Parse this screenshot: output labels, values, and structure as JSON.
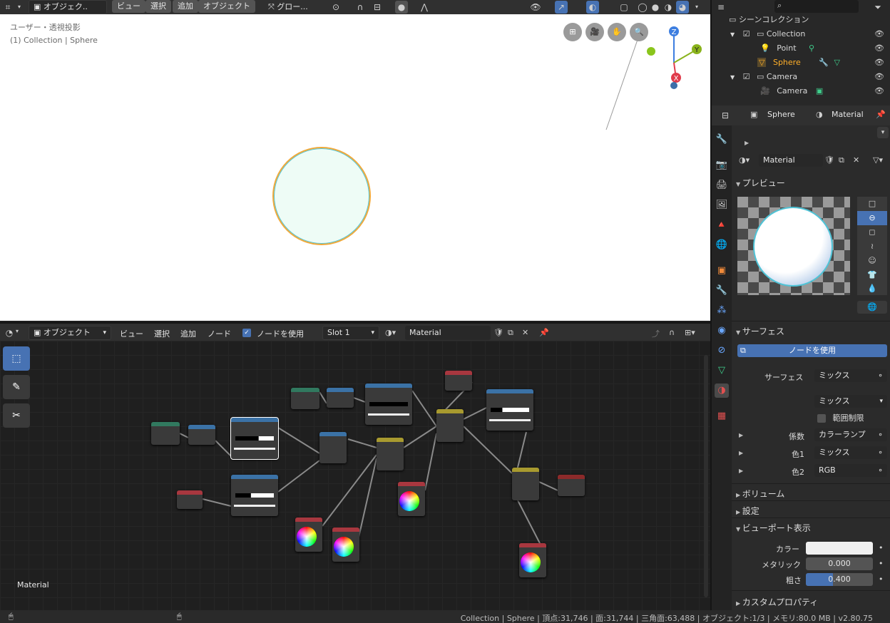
{
  "topbar": {
    "object_mode": "オブジェク..",
    "menus": [
      "ビュー",
      "選択",
      "追加",
      "オブジェクト"
    ],
    "transform": "グロー..."
  },
  "viewport": {
    "view_label": "ユーザー・透視投影",
    "object_label": "(1) Collection | Sphere",
    "axes": {
      "z": "Z",
      "y": "Y",
      "x": "X"
    }
  },
  "outliner": {
    "search_placeholder": "",
    "rows": [
      {
        "label": "シーンコレクション"
      },
      {
        "label": "Collection"
      },
      {
        "label": "Point"
      },
      {
        "label": "Sphere"
      },
      {
        "label": "Camera"
      },
      {
        "label": "Camera"
      }
    ]
  },
  "properties": {
    "breadcrumb_object": "Sphere",
    "breadcrumb_material": "Material",
    "material_name": "Material",
    "preview_panel": "プレビュー",
    "surface_panel": "サーフェス",
    "use_nodes_button": "ノードを使用",
    "surface_label": "サーフェス",
    "surface_value": "ミックス",
    "blend_value": "ミックス",
    "clamp_label": "範囲制限",
    "fac_label": "係数",
    "fac_value": "カラーランプ",
    "color1_label": "色1",
    "color1_value": "ミックス",
    "color2_label": "色2",
    "color2_value": "RGB",
    "volume_panel": "ボリューム",
    "settings_panel": "設定",
    "viewport_display_panel": "ビューポート表示",
    "color_label": "カラー",
    "metallic_label": "メタリック",
    "metallic_value": "0.000",
    "metallic": 0.0,
    "roughness_label": "粗さ",
    "roughness_value": "0.400",
    "roughness": 0.4,
    "custom_props_panel": "カスタムプロパティ"
  },
  "node_editor": {
    "mode": "オブジェクト",
    "menus": [
      "ビュー",
      "選択",
      "追加",
      "ノード"
    ],
    "use_nodes_label": "ノードを使用",
    "slot": "Slot 1",
    "material": "Material",
    "material_label": "Material"
  },
  "status_bar": {
    "text": "Collection | Sphere | 頂点:31,746 | 面:31,744 | 三角面:63,488 | オブジェクト:1/3 | メモリ:80.0 MB | v2.80.75"
  },
  "colors": {
    "accent": "#4772b3",
    "sphere_fill": "#eefcf6",
    "sphere_outline": "#f0a93b",
    "selected_text": "#ffaf29"
  }
}
